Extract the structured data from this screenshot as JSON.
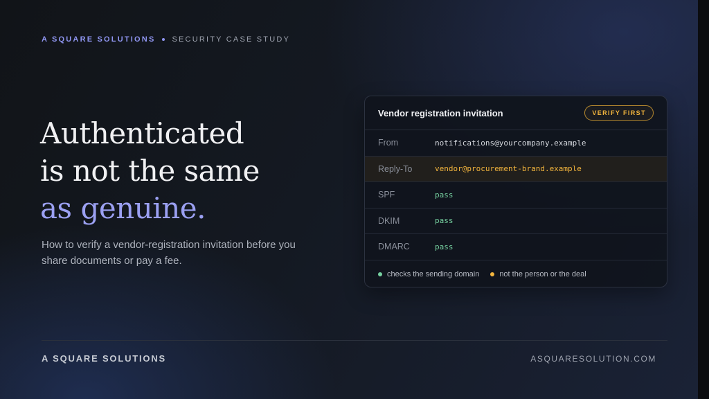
{
  "kicker": {
    "brand": "A SQUARE SOLUTIONS",
    "separator": "•",
    "topic": "SECURITY CASE STUDY"
  },
  "headline": {
    "line1": "Authenticated",
    "line2": "is not the same",
    "line3": "as genuine."
  },
  "subhead": "How to verify a vendor-registration invitation before you share documents or pay a fee.",
  "card": {
    "title": "Vendor registration invitation",
    "badge": "VERIFY FIRST",
    "rows": [
      {
        "label": "From",
        "value": "notifications@yourcompany.example"
      },
      {
        "label": "Reply-To",
        "value": "vendor@procurement-brand.example"
      },
      {
        "label": "SPF",
        "value": "pass"
      },
      {
        "label": "DKIM",
        "value": "pass"
      },
      {
        "label": "DMARC",
        "value": "pass"
      }
    ],
    "legend": [
      {
        "text": "checks the sending domain",
        "color": "#76d1a0"
      },
      {
        "text": "not the person or the deal",
        "color": "#f2b43d"
      }
    ]
  },
  "footer": {
    "brand": "A SQUARE SOLUTIONS",
    "url": "ASQUARESOLUTION.COM"
  },
  "colors": {
    "accent": "#9ba0f2",
    "pass": "#76d1a0",
    "warning": "#f2b43d"
  }
}
